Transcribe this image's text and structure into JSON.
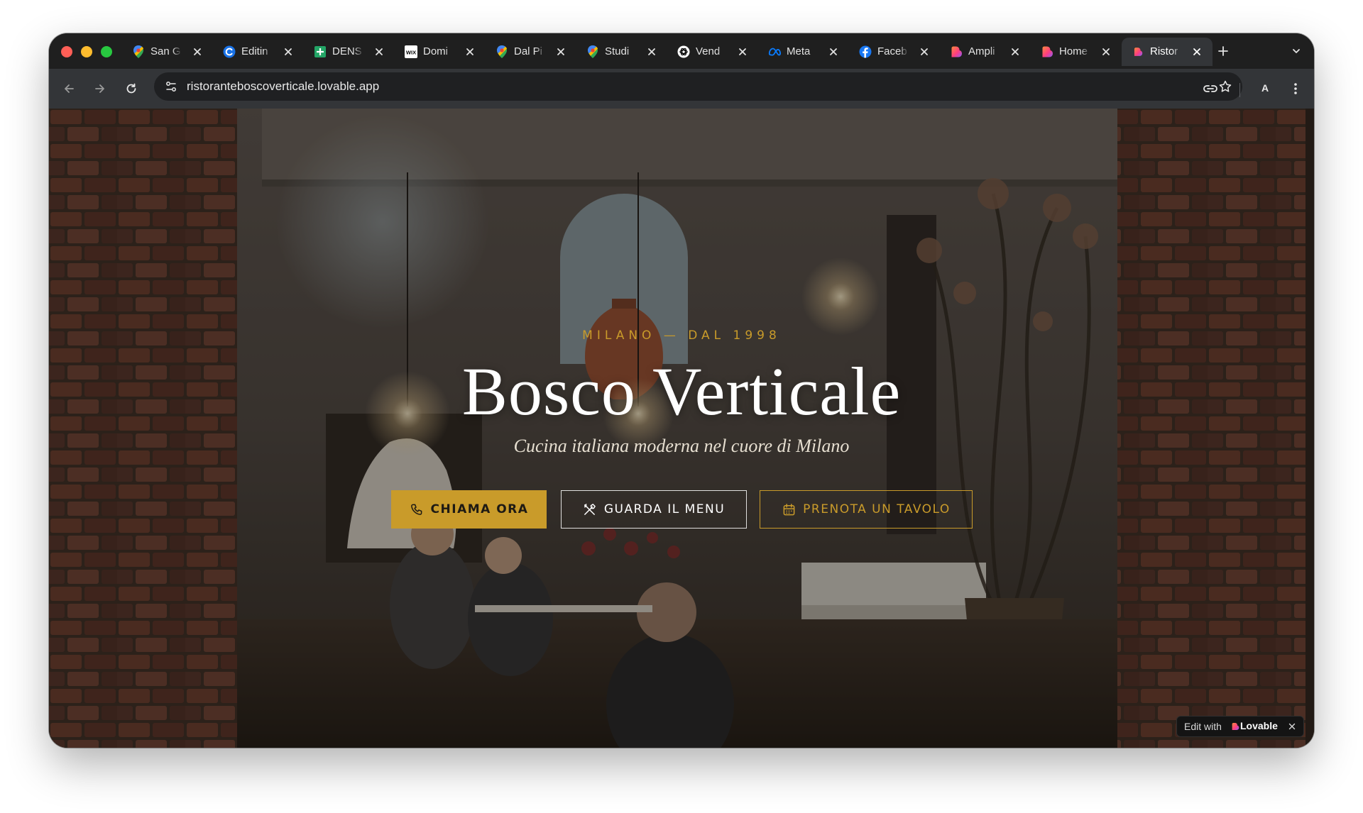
{
  "browser": {
    "tabs": [
      {
        "title": "San G",
        "icon": "google-maps-icon"
      },
      {
        "title": "Editin",
        "icon": "editor-icon"
      },
      {
        "title": "DENS",
        "icon": "google-sheets-icon"
      },
      {
        "title": "Domi",
        "icon": "wix-icon"
      },
      {
        "title": "Dal Pi",
        "icon": "google-maps-icon"
      },
      {
        "title": "Studi",
        "icon": "google-maps-icon"
      },
      {
        "title": "Vend",
        "icon": "openai-icon"
      },
      {
        "title": "Meta",
        "icon": "meta-icon"
      },
      {
        "title": "Faceb",
        "icon": "facebook-icon"
      },
      {
        "title": "Ampli",
        "icon": "lovable-icon"
      },
      {
        "title": "Home",
        "icon": "lovable-icon"
      },
      {
        "title": "Ristor",
        "icon": "lovable-icon",
        "active": true
      }
    ],
    "url": "ristoranteboscoverticale.lovable.app",
    "profile_letter": "A"
  },
  "hero": {
    "eyebrow": "MILANO — DAL 1998",
    "title": "Bosco Verticale",
    "tagline": "Cucina italiana moderna nel cuore di Milano",
    "buttons": {
      "call": "CHIAMA ORA",
      "menu": "GUARDA IL MENU",
      "book": "PRENOTA UN TAVOLO"
    }
  },
  "badge": {
    "edit_with": "Edit with",
    "brand": "Lovable"
  },
  "colors": {
    "accent_gold": "#c99b2a",
    "browser_dark": "#1f1f1f",
    "toolbar": "#333538"
  }
}
